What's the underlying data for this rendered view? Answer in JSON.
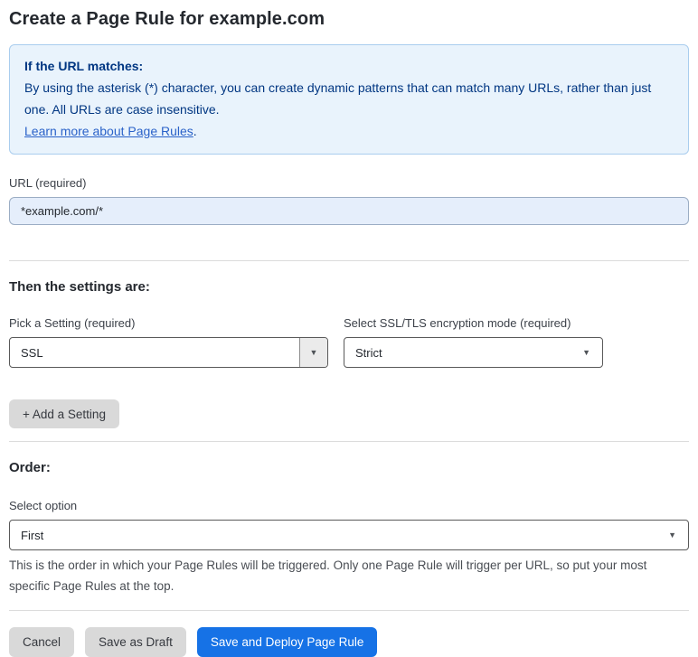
{
  "page": {
    "title": "Create a Page Rule for example.com"
  },
  "info_box": {
    "heading": "If the URL matches:",
    "body": "By using the asterisk (*) character, you can create dynamic patterns that can match many URLs, rather than just one. All URLs are case insensitive.",
    "link_label": "Learn more about Page Rules",
    "link_suffix": "."
  },
  "url_field": {
    "label": "URL (required)",
    "value": "*example.com/*"
  },
  "settings": {
    "heading": "Then the settings are:",
    "pick_setting": {
      "label": "Pick a Setting (required)",
      "value": "SSL"
    },
    "ssl_mode": {
      "label": "Select SSL/TLS encryption mode (required)",
      "value": "Strict"
    },
    "add_button_label": "+ Add a Setting"
  },
  "order": {
    "heading": "Order:",
    "select_label": "Select option",
    "value": "First",
    "help_text": "This is the order in which your Page Rules will be triggered. Only one Page Rule will trigger per URL, so put your most specific Page Rules at the top."
  },
  "footer": {
    "cancel_label": "Cancel",
    "save_draft_label": "Save as Draft",
    "save_deploy_label": "Save and Deploy Page Rule"
  },
  "icons": {
    "dropdown_arrow": "▼"
  },
  "colors": {
    "info_bg": "#e9f3fc",
    "info_border": "#a9cdee",
    "info_text": "#003682",
    "link_blue": "#2a62c9",
    "input_bg": "#e5eefb",
    "primary_button": "#1672e6",
    "gray_button": "#d9d9d9"
  }
}
